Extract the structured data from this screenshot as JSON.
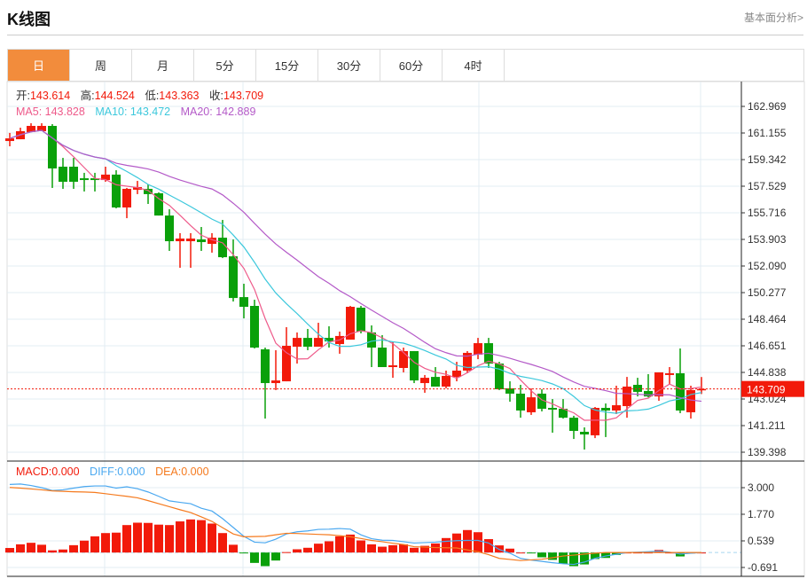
{
  "header": {
    "title": "K线图",
    "link": "基本面分析>"
  },
  "tabs": [
    {
      "label": "日",
      "active": true
    },
    {
      "label": "周"
    },
    {
      "label": "月"
    },
    {
      "label": "5分"
    },
    {
      "label": "15分"
    },
    {
      "label": "30分"
    },
    {
      "label": "60分"
    },
    {
      "label": "4时"
    }
  ],
  "ohlc_info": {
    "open_label": "开:",
    "open": "143.614",
    "high_label": "高:",
    "high": "144.524",
    "low_label": "低:",
    "low": "143.363",
    "close_label": "收:",
    "close": "143.709"
  },
  "ma_info": {
    "ma5": "MA5: 143.828",
    "ma10": "MA10: 143.472",
    "ma20": "MA20: 142.889"
  },
  "macd_info": {
    "macd": "MACD:0.000",
    "diff": "DIFF:0.000",
    "dea": "DEA:0.000"
  },
  "current_price": "143.709",
  "colors": {
    "up": "#f21a0a",
    "down": "#0aa00a",
    "ma5": "#ee5a8a",
    "ma10": "#3cc8dc",
    "ma20": "#b45ac8",
    "diff": "#4aa8f0",
    "dea": "#f57a1e",
    "accent": "#f28c3c"
  },
  "chart_data": {
    "type": "candlestick",
    "price_ticks": [
      "162.969",
      "161.155",
      "159.342",
      "157.529",
      "155.716",
      "153.903",
      "152.090",
      "150.277",
      "148.464",
      "146.651",
      "144.838",
      "143.024",
      "141.211",
      "139.398"
    ],
    "price_range": [
      139.398,
      162.969
    ],
    "macd_ticks": [
      "3.000",
      "1.770",
      "0.539",
      "-0.691"
    ],
    "macd_range": [
      -0.691,
      3.0
    ],
    "ohlc": [
      [
        160.61,
        161.16,
        160.25,
        160.79
      ],
      [
        160.73,
        161.52,
        160.73,
        161.28
      ],
      [
        161.22,
        161.82,
        161.22,
        161.64
      ],
      [
        161.28,
        161.82,
        161.28,
        161.64
      ],
      [
        161.64,
        161.76,
        157.41,
        158.74
      ],
      [
        158.86,
        159.46,
        157.35,
        157.83
      ],
      [
        158.86,
        159.46,
        157.35,
        157.83
      ],
      [
        158.07,
        158.44,
        157.17,
        157.95
      ],
      [
        158.07,
        158.44,
        157.17,
        157.95
      ],
      [
        157.95,
        158.86,
        157.83,
        158.32
      ],
      [
        158.32,
        158.62,
        156.02,
        156.08
      ],
      [
        156.08,
        157.41,
        155.35,
        157.35
      ],
      [
        157.29,
        157.89,
        156.99,
        157.47
      ],
      [
        157.35,
        157.65,
        156.32,
        156.99
      ],
      [
        157.05,
        157.11,
        155.53,
        155.53
      ],
      [
        155.53,
        155.96,
        153.12,
        153.78
      ],
      [
        153.78,
        154.33,
        151.97,
        153.96
      ],
      [
        153.78,
        154.33,
        151.97,
        153.96
      ],
      [
        153.9,
        154.75,
        153.12,
        153.72
      ],
      [
        153.6,
        154.33,
        153.0,
        154.02
      ],
      [
        154.02,
        155.23,
        152.63,
        152.69
      ],
      [
        152.75,
        153.9,
        149.67,
        149.91
      ],
      [
        149.97,
        150.88,
        148.52,
        149.31
      ],
      [
        149.37,
        149.79,
        146.47,
        146.53
      ],
      [
        146.41,
        146.53,
        141.69,
        144.11
      ],
      [
        144.11,
        146.35,
        143.63,
        144.29
      ],
      [
        144.23,
        147.92,
        144.23,
        146.65
      ],
      [
        146.59,
        147.56,
        145.44,
        147.19
      ],
      [
        147.19,
        147.8,
        146.35,
        146.59
      ],
      [
        146.59,
        148.22,
        146.59,
        147.19
      ],
      [
        147.19,
        147.98,
        146.53,
        146.95
      ],
      [
        146.77,
        147.62,
        146.11,
        147.32
      ],
      [
        147.07,
        149.37,
        147.07,
        149.31
      ],
      [
        149.25,
        149.37,
        147.5,
        147.62
      ],
      [
        147.56,
        148.04,
        145.2,
        146.53
      ],
      [
        146.53,
        147.38,
        145.2,
        145.2
      ],
      [
        145.2,
        146.95,
        144.47,
        145.32
      ],
      [
        145.14,
        146.53,
        144.84,
        146.29
      ],
      [
        146.29,
        146.29,
        144.11,
        144.29
      ],
      [
        144.11,
        144.66,
        143.45,
        144.47
      ],
      [
        144.53,
        145.2,
        143.87,
        143.87
      ],
      [
        143.87,
        144.96,
        143.75,
        144.6
      ],
      [
        144.53,
        145.56,
        144.23,
        144.96
      ],
      [
        144.96,
        146.29,
        144.78,
        146.17
      ],
      [
        146.05,
        147.19,
        145.74,
        146.83
      ],
      [
        146.83,
        147.19,
        145.14,
        145.44
      ],
      [
        145.44,
        145.56,
        143.63,
        143.69
      ],
      [
        143.75,
        144.23,
        142.84,
        143.39
      ],
      [
        143.39,
        143.99,
        141.75,
        142.24
      ],
      [
        142.12,
        143.75,
        141.94,
        143.14
      ],
      [
        143.39,
        143.69,
        142.18,
        142.36
      ],
      [
        142.42,
        143.02,
        140.73,
        142.3
      ],
      [
        142.36,
        143.02,
        141.69,
        141.75
      ],
      [
        141.75,
        141.88,
        140.3,
        140.85
      ],
      [
        140.79,
        141.09,
        139.58,
        140.61
      ],
      [
        140.55,
        142.48,
        140.36,
        142.42
      ],
      [
        142.42,
        142.72,
        140.43,
        142.24
      ],
      [
        142.24,
        143.93,
        142.0,
        142.6
      ],
      [
        142.54,
        144.53,
        141.75,
        143.87
      ],
      [
        143.99,
        144.47,
        143.2,
        143.51
      ],
      [
        143.57,
        144.72,
        143.14,
        143.2
      ],
      [
        143.2,
        144.84,
        142.9,
        144.84
      ],
      [
        144.66,
        145.2,
        144.05,
        144.78
      ],
      [
        144.78,
        146.47,
        142.06,
        142.24
      ],
      [
        142.12,
        143.93,
        141.69,
        143.63
      ],
      [
        143.614,
        144.524,
        143.363,
        143.709
      ]
    ],
    "macd_hist": [
      0.21,
      0.38,
      0.45,
      0.36,
      0.1,
      0.14,
      0.34,
      0.55,
      0.75,
      0.9,
      0.92,
      1.27,
      1.38,
      1.37,
      1.29,
      1.27,
      1.44,
      1.53,
      1.5,
      1.34,
      0.9,
      0.36,
      -0.03,
      -0.48,
      -0.63,
      -0.37,
      0.02,
      0.15,
      0.22,
      0.41,
      0.52,
      0.75,
      0.83,
      0.56,
      0.38,
      0.27,
      0.34,
      0.38,
      0.22,
      0.31,
      0.42,
      0.67,
      0.88,
      1.04,
      0.94,
      0.62,
      0.33,
      0.18,
      0.0,
      -0.03,
      -0.22,
      -0.34,
      -0.52,
      -0.63,
      -0.55,
      -0.3,
      -0.25,
      -0.11,
      0,
      0,
      0,
      0.12,
      0,
      -0.18,
      0,
      0
    ],
    "diff": [
      3.15,
      3.17,
      3.1,
      3.0,
      2.87,
      2.9,
      2.98,
      3.05,
      3.08,
      3.08,
      2.98,
      3.04,
      2.95,
      2.8,
      2.6,
      2.39,
      2.32,
      2.26,
      2.05,
      1.92,
      1.57,
      1.16,
      0.75,
      0.48,
      0.45,
      0.62,
      0.86,
      0.96,
      1.0,
      1.07,
      1.08,
      1.11,
      1.08,
      0.82,
      0.64,
      0.57,
      0.56,
      0.5,
      0.44,
      0.46,
      0.48,
      0.52,
      0.55,
      0.56,
      0.56,
      0.44,
      0.14,
      -0.03,
      -0.27,
      -0.35,
      -0.41,
      -0.47,
      -0.52,
      -0.55,
      -0.44,
      -0.27,
      -0.16,
      -0.08,
      0,
      0.02,
      0.04,
      0.07,
      0.02,
      -0.07,
      -0.03,
      0
    ],
    "dea": [
      3.01,
      2.98,
      2.94,
      2.9,
      2.85,
      2.83,
      2.81,
      2.8,
      2.78,
      2.72,
      2.66,
      2.6,
      2.53,
      2.4,
      2.26,
      2.12,
      1.98,
      1.85,
      1.65,
      1.44,
      1.15,
      0.86,
      0.73,
      0.74,
      0.75,
      0.82,
      0.89,
      0.88,
      0.86,
      0.84,
      0.82,
      0.78,
      0.73,
      0.65,
      0.56,
      0.5,
      0.43,
      0.37,
      0.27,
      0.25,
      0.23,
      0.22,
      0.21,
      0.12,
      0.04,
      -0.1,
      -0.27,
      -0.32,
      -0.37,
      -0.34,
      -0.31,
      -0.24,
      -0.16,
      -0.12,
      -0.07,
      -0.03,
      0,
      0,
      0,
      0,
      0,
      0,
      0,
      0,
      0,
      0
    ]
  }
}
